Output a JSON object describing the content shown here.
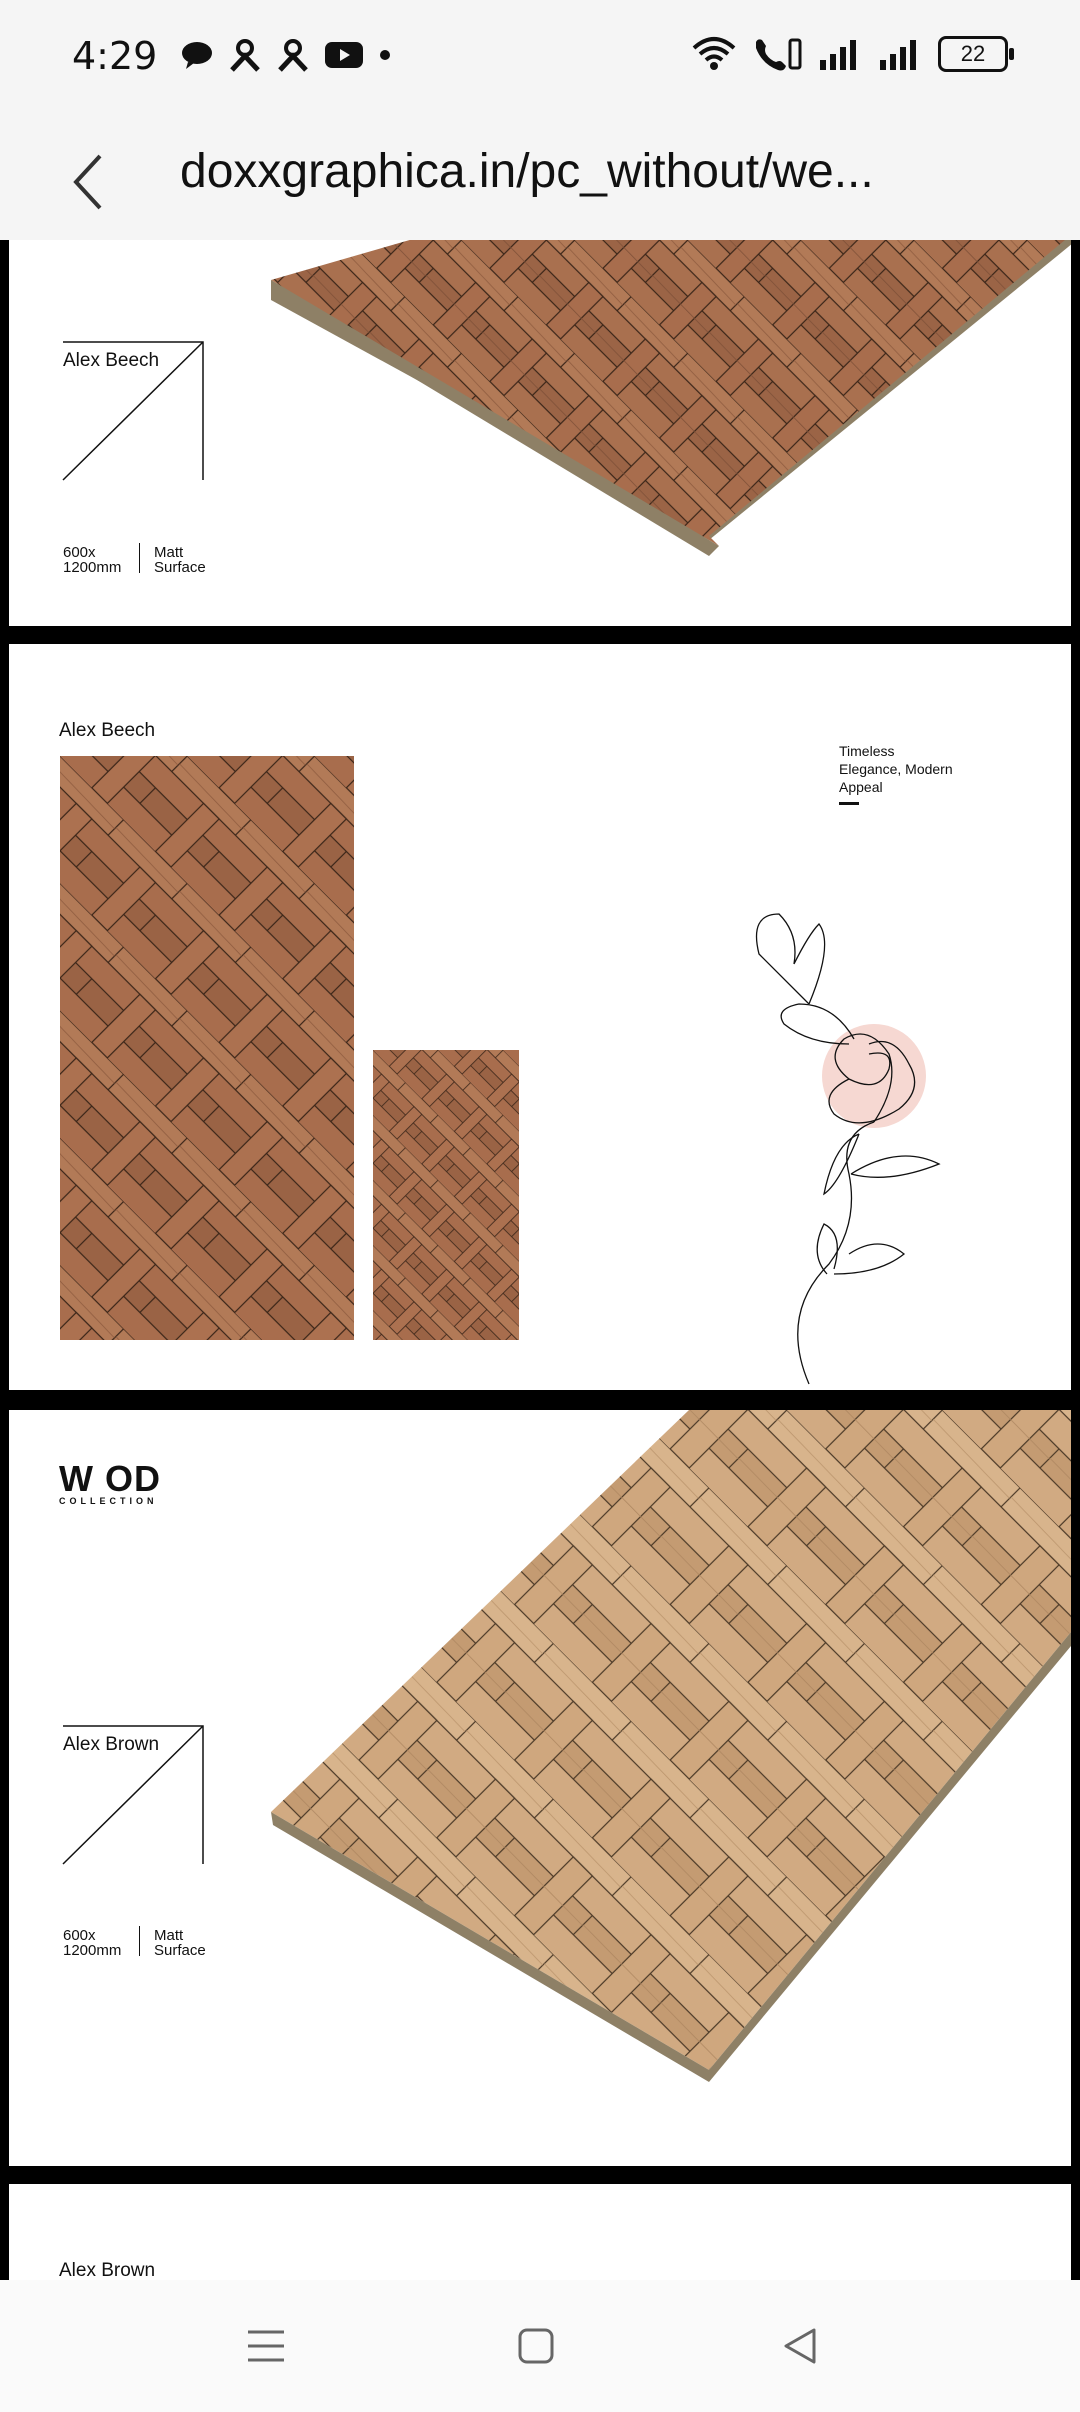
{
  "status": {
    "time": "4:29",
    "battery": "22",
    "left_icons": [
      "chat-bubble-icon",
      "person-icon",
      "person-icon",
      "youtube-icon",
      "dot-icon"
    ],
    "right_icons": [
      "wifi-icon",
      "wifi-calling-icon",
      "signal-icon",
      "signal-icon",
      "battery-icon"
    ]
  },
  "browser": {
    "url": "doxxgraphica.in/pc_without/we..."
  },
  "cards": [
    {
      "name": "Alex Beech",
      "size": "600x\n1200mm",
      "surface": "Matt\nSurface",
      "tile_color": "#a46a4a"
    },
    {
      "name": "Alex Beech",
      "tagline": "Timeless\nElegance, Modern\nAppeal",
      "tile_color": "#a46a4a"
    },
    {
      "logo_top": "W  OD",
      "logo_bottom": "COLLECTION",
      "name": "Alex Brown",
      "size": "600x\n1200mm",
      "surface": "Matt\nSurface",
      "tile_color": "#d2aa80"
    },
    {
      "name": "Alex Brown"
    }
  ],
  "nav": {
    "icons": [
      "menu-icon",
      "home-square-icon",
      "back-triangle-icon"
    ]
  }
}
